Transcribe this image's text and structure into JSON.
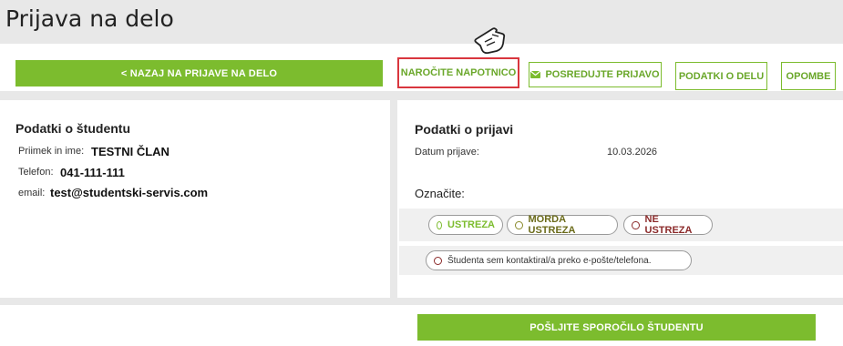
{
  "page_title": "Prijava na delo",
  "toolbar": {
    "back_label": "< NAZAJ NA PRIJAVE NA DELO",
    "order_label": "NAROČITE NAPOTNICO",
    "forward_label": "POSREDUJTE PRIJAVO",
    "job_label": "PODATKI O DELU",
    "notes_label": "OPOMBE"
  },
  "student": {
    "heading": "Podatki o študentu",
    "name_label": "Priimek in ime:",
    "name_value": "TESTNI ČLAN",
    "phone_label": "Telefon:",
    "phone_value": "041-111-111",
    "email_label": "email:",
    "email_value": "test@studentski-servis.com"
  },
  "application": {
    "heading": "Podatki o prijavi",
    "date_label": "Datum prijave:",
    "date_value": "10.03.2026",
    "mark_label": "Označite:",
    "options": [
      "USTREZA",
      "MORDA USTREZA",
      "NE USTREZA"
    ],
    "contacted_label": "Študenta sem kontaktiral/a preko e-pošte/telefona."
  },
  "send_label": "POŠLJITE SPOROČILO ŠTUDENTU",
  "colors": {
    "accent": "#7cbc2e",
    "highlight": "#d9363e",
    "negative": "#8b2a2a"
  },
  "icons": {
    "pointer": "hand-pointer-icon",
    "envelope": "envelope-icon"
  }
}
